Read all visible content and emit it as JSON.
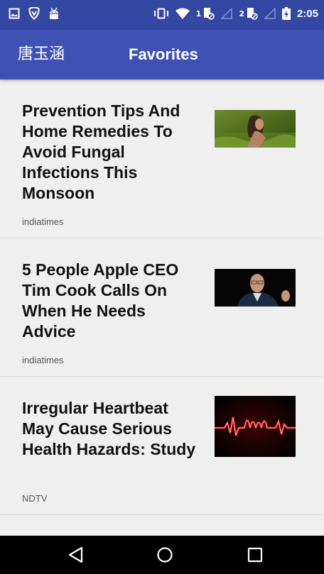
{
  "status_bar": {
    "time": "2:05",
    "sim1_label": "1",
    "sim2_label": "2",
    "icons": [
      "image-icon",
      "shield-icon",
      "android-icon",
      "vibrate-icon",
      "wifi-icon",
      "sim1-signal-icon",
      "sim2-signal-icon",
      "battery-charging-icon"
    ]
  },
  "app_bar": {
    "user_name": "唐玉涵",
    "title": "Favorites"
  },
  "articles": [
    {
      "title": "Prevention Tips And Home Remedies To Avoid Fungal Infections This Monsoon",
      "source": "indiatimes",
      "thumbnail": "woman-in-field-image"
    },
    {
      "title": "5 People Apple CEO Tim Cook Calls On When He Needs Advice",
      "source": "indiatimes",
      "thumbnail": "tim-cook-image"
    },
    {
      "title": "Irregular Heartbeat May Cause Serious Health Hazards: Study",
      "source": "NDTV",
      "thumbnail": "heartbeat-help-image"
    }
  ],
  "nav_bar": {
    "icons": [
      "back-icon",
      "home-icon",
      "recents-icon"
    ]
  },
  "colors": {
    "status_bar": "#3347a3",
    "app_bar": "#3f51b5",
    "background": "#efefef",
    "nav_bar": "#000000"
  }
}
